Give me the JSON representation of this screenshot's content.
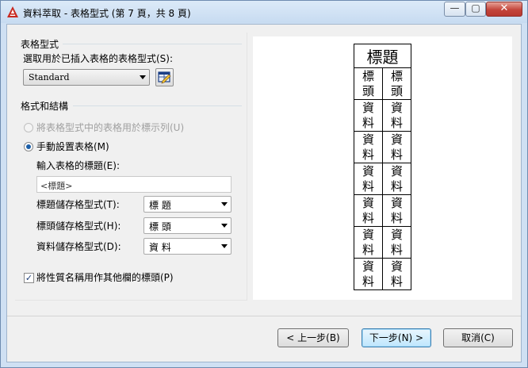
{
  "window": {
    "title": "資料萃取 - 表格型式 (第 7 頁，共 8 頁)",
    "min_label": "—",
    "max_label": "▢",
    "close_label": "✕"
  },
  "table_style": {
    "section_title": "表格型式",
    "select_label": "選取用於已插入表格的表格型式(S):",
    "selected_style": "Standard"
  },
  "format": {
    "section_title": "格式和結構",
    "radio_legend_label": "將表格型式中的表格用於標示列(U)",
    "radio_manual_label": "手動設置表格(M)",
    "title_input_label": "輸入表格的標題(E):",
    "title_input_value": "<標題>",
    "title_cell_style_label": "標題儲存格型式(T):",
    "title_cell_style_value": "標 題",
    "header_cell_style_label": "標頭儲存格型式(H):",
    "header_cell_style_value": "標 頭",
    "data_cell_style_label": "資料儲存格型式(D):",
    "data_cell_style_value": "資 料",
    "property_name_checkbox_label": "將性質名稱用作其他欄的標頭(P)",
    "property_name_checked": true
  },
  "preview": {
    "title_cell": "標題",
    "header_cells": [
      "標\n頭",
      "標\n頭"
    ],
    "data_rows": [
      [
        "資\n料",
        "資\n料"
      ],
      [
        "資\n料",
        "資\n料"
      ],
      [
        "資\n料",
        "資\n料"
      ],
      [
        "資\n料",
        "資\n料"
      ],
      [
        "資\n料",
        "資\n料"
      ],
      [
        "資\n料",
        "資\n料"
      ]
    ]
  },
  "buttons": {
    "back": "< 上一步(B)",
    "next": "下一步(N) >",
    "cancel": "取消(C)"
  }
}
